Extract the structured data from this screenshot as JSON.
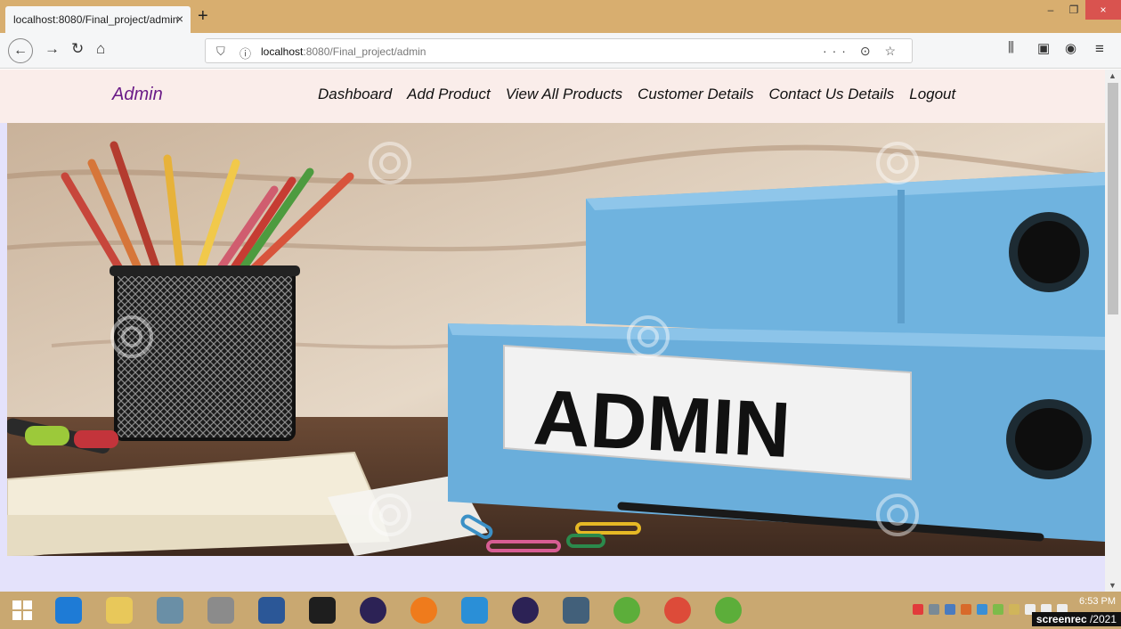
{
  "browser": {
    "tab_title": "localhost:8080/Final_project/admin",
    "tab_close": "×",
    "new_tab": "+",
    "url_host": "localhost",
    "url_path": ":8080/Final_project/admin",
    "url_actions": "··· ⊙ ☆",
    "window_controls": [
      "–",
      "❐",
      "×"
    ]
  },
  "site": {
    "brand": "Admin",
    "nav": [
      "Dashboard",
      "Add Product",
      "View All Products",
      "Customer Details",
      "Contact Us Details",
      "Logout"
    ]
  },
  "hero": {
    "label": "ADMIN",
    "watermark": "dreamstime"
  },
  "taskbar": {
    "time": "6:53 PM",
    "date_suffix": "/2021",
    "recorder": "screenrec"
  },
  "colors": {
    "tabbar": "#d8ae6f",
    "header_bg": "#faedea",
    "page_bg": "#e4e2fb",
    "brand": "#6a1a87",
    "binder_blue": "#5aa9d9"
  },
  "icons": [
    "back-arrow-icon",
    "forward-arrow-icon",
    "reload-icon",
    "home-icon",
    "shield-icon",
    "info-icon",
    "library-icon",
    "sidebar-icon",
    "account-icon",
    "menu-icon",
    "windows-start-icon"
  ]
}
